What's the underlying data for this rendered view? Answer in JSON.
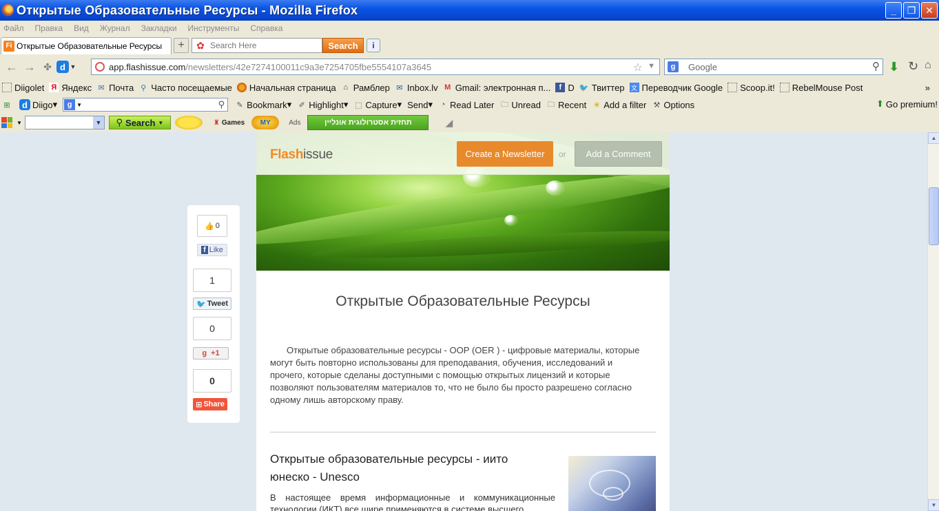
{
  "window": {
    "title": "Открытые Образовательные Ресурсы - Mozilla Firefox",
    "controls": [
      "_",
      "❐",
      "✕"
    ]
  },
  "menu": [
    "Файл",
    "Правка",
    "Вид",
    "Журнал",
    "Закладки",
    "Инструменты",
    "Справка"
  ],
  "tab": {
    "favicon": "Fi",
    "label": "Открытые Образовательные Ресурсы",
    "new_tab": "+"
  },
  "toolbar_search": {
    "placeholder": "Search Here",
    "button": "Search",
    "info": "i"
  },
  "nav": {
    "url_host": "app.flashissue.com",
    "url_path": "/newsletters/42e7274100011c9a3e7254705fbe5554107a3645",
    "search_engine_placeholder": "Google"
  },
  "bookmarks": [
    {
      "label": "Diigolet",
      "icon": "dotted-icon"
    },
    {
      "label": "Яндекс",
      "icon": "yandex-icon"
    },
    {
      "label": "Почта",
      "icon": "mail-icon"
    },
    {
      "label": "Часто посещаемые",
      "icon": "magnifier-icon"
    },
    {
      "label": "Начальная страница",
      "icon": "firefox-icon"
    },
    {
      "label": "Рамблер",
      "icon": "house-icon"
    },
    {
      "label": "Inbox.lv",
      "icon": "inbox-icon"
    },
    {
      "label": "Gmail: электронная п...",
      "icon": "gmail-icon"
    },
    {
      "label": "D",
      "icon": "facebook-icon"
    },
    {
      "label": "Твиттер",
      "icon": "twitter-icon"
    },
    {
      "label": "Переводчик Google",
      "icon": "translate-icon"
    },
    {
      "label": "Scoop.it!",
      "icon": "dotted-icon"
    },
    {
      "label": "RebelMouse Post",
      "icon": "dotted-icon"
    }
  ],
  "diigo": {
    "brand": "Diigo",
    "items": [
      "Bookmark",
      "Highlight",
      "Capture",
      "Send",
      "Read Later",
      "Unread",
      "Recent",
      "Add a filter",
      "Options"
    ],
    "go_premium": "Go premium!"
  },
  "ads_toolbar": {
    "search": "Search",
    "games": "Games",
    "my": "MY",
    "ads": "Ads",
    "banner": "תחזית אסטרולוגית אונליין"
  },
  "share": {
    "like_count": "0",
    "like_label": "Like",
    "tweet_count": "1",
    "tweet_label": "Tweet",
    "gplus_count": "0",
    "gplus_label": "+1",
    "share_count": "0",
    "share_label": "Share"
  },
  "newsletter": {
    "logo_flash": "Flash",
    "logo_issue": "issue",
    "create_button": "Create a Newsletter",
    "or": "or",
    "comment_button": "Add a Comment",
    "title": "Открытые Образовательные Ресурсы",
    "intro": "Открытые образовательные ресурсы - ООР (OER ) - цифровые материалы, которые могут быть повторно использованы для преподавания, обучения, исследований и прочего, которые сделаны доступными с помощью открытых лицензий и которые позволяют пользователям материалов то, что не было бы просто разрешено согласно одному лишь авторскому праву.",
    "article_title": "Открытые образовательные ресурсы - иито юнеско - Unesco",
    "article_text": "В настоящее время информационные и коммуникационные технологии (ИКТ) все шире применяются в системе высшего"
  }
}
